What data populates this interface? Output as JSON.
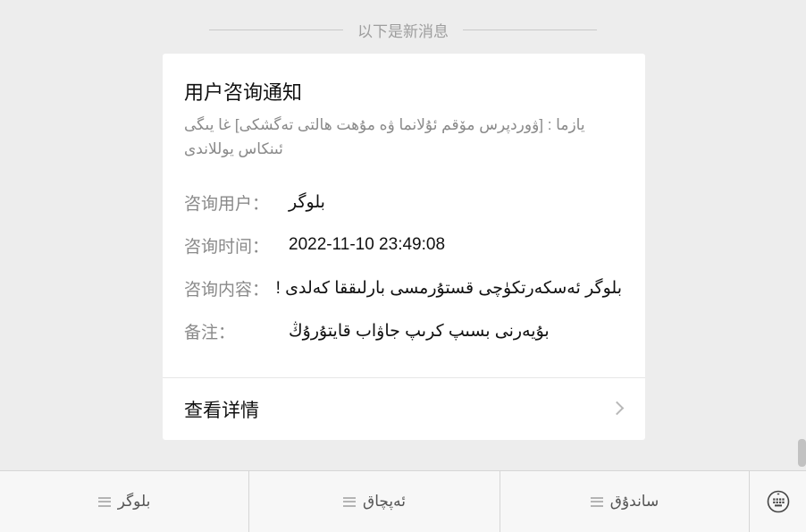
{
  "divider": {
    "text": "以下是新消息"
  },
  "card": {
    "title": "用户咨询通知",
    "description": "يازما : [ۋوردپرس مۆقم ئۇلانما ۋە مۇهت هالتى تەگشكى]  غا يىگى ئىنكاس يوللاندى",
    "fields": [
      {
        "label": "咨询用户：",
        "value": "بلوگر"
      },
      {
        "label": "咨询时间：",
        "value": "2022-11-10 23:49:08"
      },
      {
        "label": "咨询内容：",
        "value": "بلوگر ئەسكەرتكۈچى قستۇرمسى بارلىققا كەلدى !"
      },
      {
        "label": "备注：",
        "value": "بۇيەرنى بسىپ كرىپ جاۋاب قايتۇرۇڭ"
      }
    ],
    "detail_label": "查看详情",
    "detail_icon": "chevron-right-icon"
  },
  "menu": {
    "tabs": [
      {
        "label": "بلوگر",
        "icon": "menu-lines-icon"
      },
      {
        "label": "ئەپچاق",
        "icon": "menu-lines-icon"
      },
      {
        "label": "ساندۇق",
        "icon": "menu-lines-icon"
      }
    ],
    "keyboard_icon": "keyboard-icon"
  }
}
